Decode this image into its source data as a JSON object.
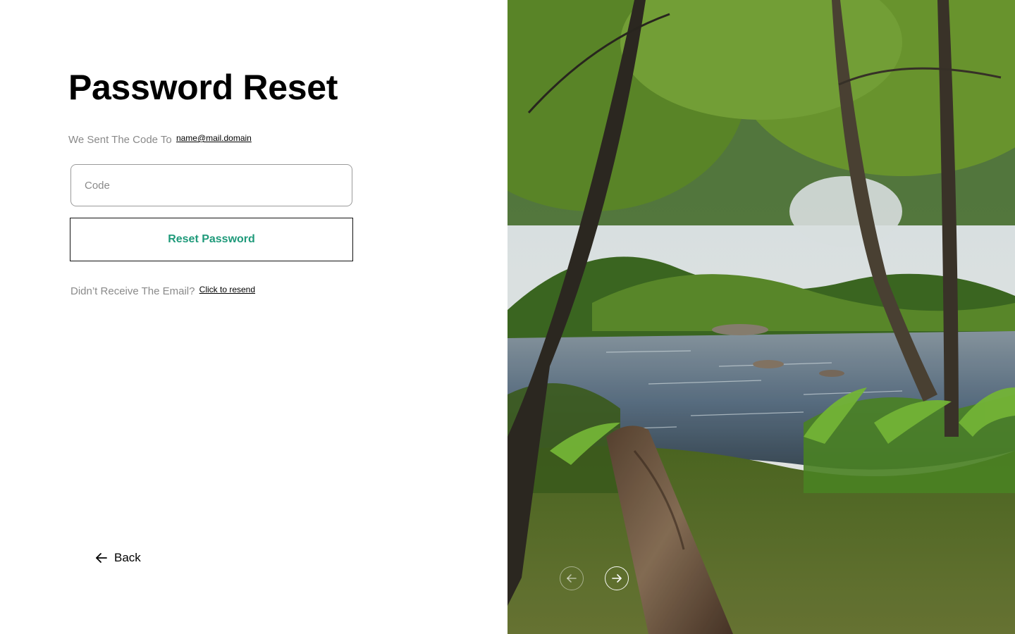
{
  "page": {
    "title": "Password Reset",
    "sent_prefix": "We Sent The Code To",
    "email": "name@mail.domain"
  },
  "form": {
    "code_placeholder": "Code",
    "code_value": "",
    "submit_label": "Reset Password"
  },
  "resend": {
    "prefix": "Didn’t Receive The Email?",
    "link_label": "Click to resend"
  },
  "nav": {
    "back_label": "Back"
  },
  "gallery": {
    "image_subject": "forest river scene with fallen log",
    "prev_icon": "arrow-left-circle-icon",
    "next_icon": "arrow-right-circle-icon"
  },
  "colors": {
    "accent": "#1f9a7a",
    "muted_text": "#8a8a8a",
    "border": "#9a9a9a"
  }
}
